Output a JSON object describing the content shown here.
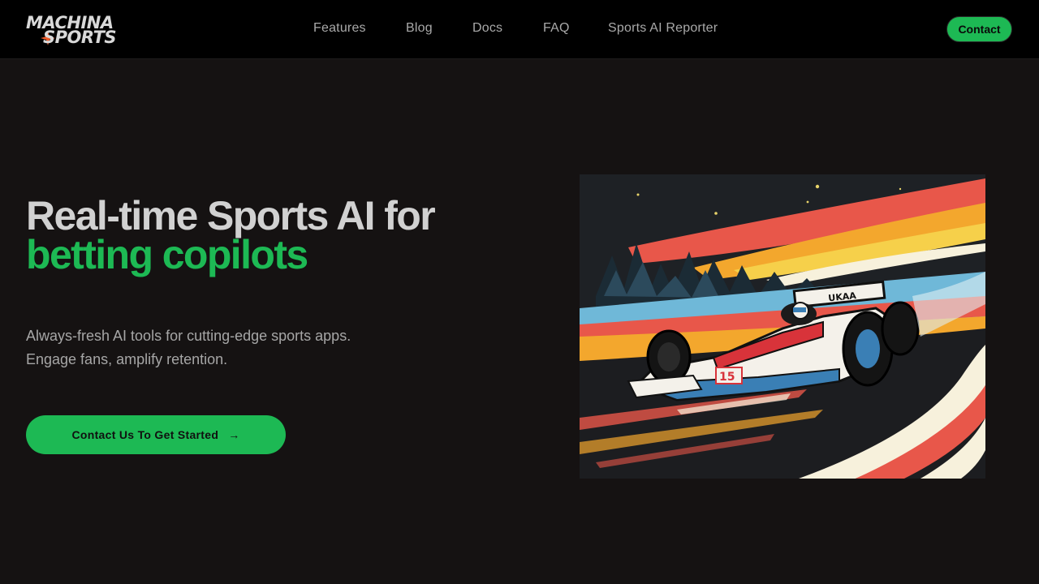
{
  "header": {
    "logo": {
      "line1": "MACHINA",
      "line2": "SPORTS"
    },
    "nav": [
      {
        "label": "Features"
      },
      {
        "label": "Blog"
      },
      {
        "label": "Docs"
      },
      {
        "label": "FAQ"
      },
      {
        "label": "Sports AI Reporter"
      }
    ],
    "contact_label": "Contact"
  },
  "hero": {
    "title_line1": "Real-time Sports AI for",
    "title_line2": "betting copilots",
    "subtitle_line1": "Always-fresh AI tools for cutting-edge sports apps.",
    "subtitle_line2": "Engage fans, amplify retention.",
    "cta_label": "Contact Us To Get Started",
    "cta_icon": "arrow-right-icon",
    "illustration": {
      "subject": "race-car-illustration",
      "car_markings": [
        "UKAA",
        "15"
      ]
    }
  },
  "colors": {
    "accent": "#1db954",
    "background": "#151212",
    "header_bg": "#000000",
    "logo_star": "#f05a28"
  }
}
